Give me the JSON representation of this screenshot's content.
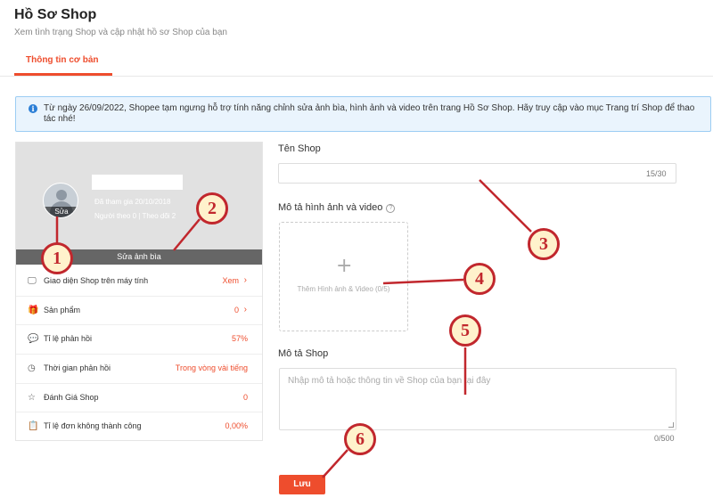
{
  "page": {
    "title": "Hồ Sơ Shop",
    "subtitle": "Xem tình trạng Shop và cập nhật hồ sơ Shop của bạn"
  },
  "tabs": [
    {
      "label": "Thông tin cơ bản",
      "active": true
    }
  ],
  "notice": {
    "text": "Từ ngày 26/09/2022, Shopee tạm ngưng hỗ trợ tính năng chỉnh sửa ảnh bìa, hình ảnh và video trên trang Hồ Sơ Shop. Hãy truy cập vào mục Trang trí Shop để thao tác nhé!"
  },
  "profile_card": {
    "avatar_edit_label": "Sửa",
    "joined": "Đã tham gia 20/10/2018",
    "followers": "Người theo 0  |  Theo dõi 2",
    "cover_edit_label": "Sửa ảnh bìa",
    "stats": [
      {
        "icon": "monitor-icon",
        "label": "Giao diện Shop trên máy tính",
        "value": "Xem",
        "arrow": true
      },
      {
        "icon": "box-icon",
        "label": "Sản phẩm",
        "value": "0",
        "arrow": true
      },
      {
        "icon": "chat-icon",
        "label": "Tỉ lệ phản hồi",
        "value": "57%",
        "arrow": false
      },
      {
        "icon": "clock-icon",
        "label": "Thời gian phản hồi",
        "value": "Trong vòng vài tiếng",
        "arrow": false
      },
      {
        "icon": "star-icon",
        "label": "Đánh Giá Shop",
        "value": "0",
        "arrow": false
      },
      {
        "icon": "clipboard-icon",
        "label": "Tỉ lệ đơn không thành công",
        "value": "0,00%",
        "arrow": true
      }
    ]
  },
  "form": {
    "shop_name": {
      "label": "Tên Shop",
      "value": "",
      "counter": "15/30"
    },
    "media": {
      "label": "Mô tả hình ảnh và video",
      "upload_label": "Thêm Hình ảnh & Video (0/5)"
    },
    "description": {
      "label": "Mô tả Shop",
      "placeholder": "Nhập mô tả hoặc thông tin về Shop của bạn tại đây",
      "counter": "0/500"
    },
    "save_label": "Lưu"
  },
  "annotations": [
    "1",
    "2",
    "3",
    "4",
    "5",
    "6"
  ],
  "colors": {
    "accent": "#ee4d2d",
    "annotation": "#c1272d",
    "badge_fill": "#fff2cc",
    "notice_bg": "#eaf4fd"
  }
}
